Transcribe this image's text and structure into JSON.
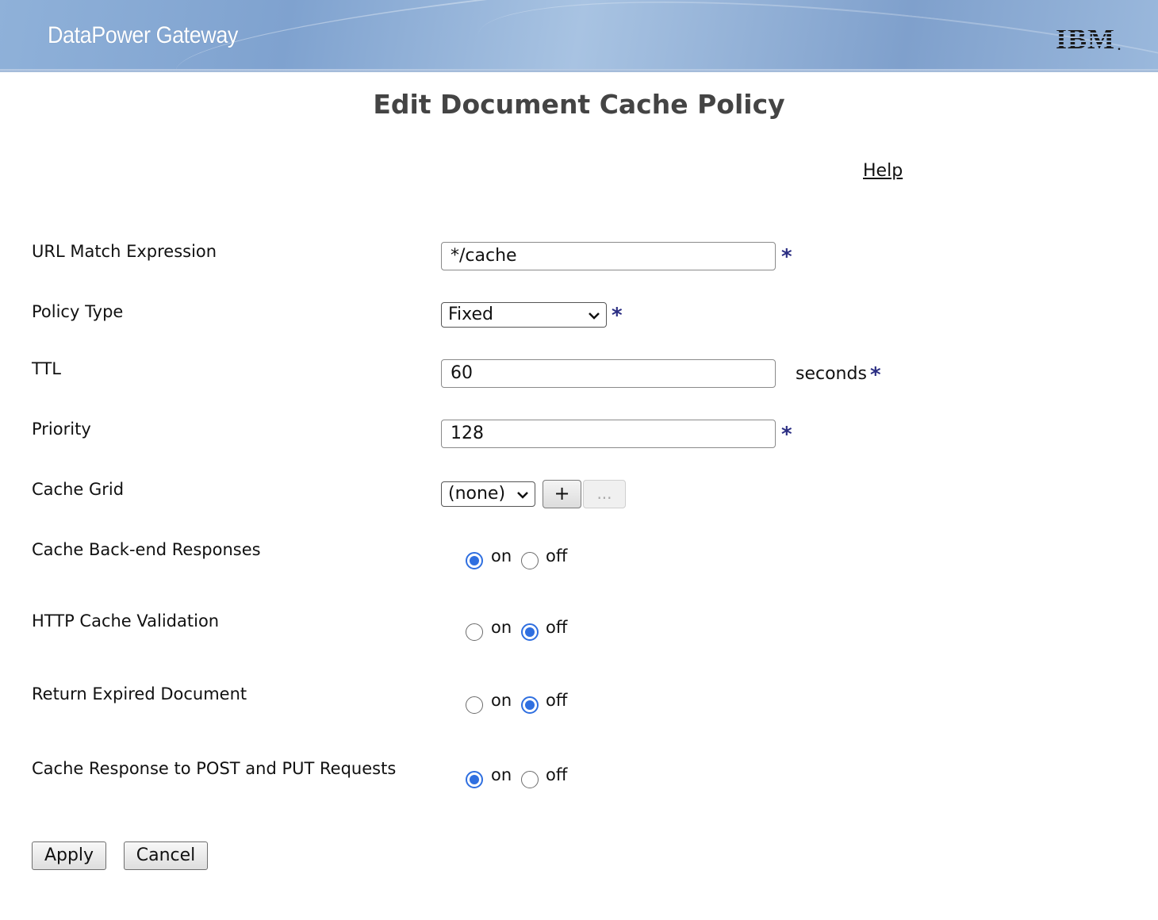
{
  "header": {
    "product_name": "DataPower Gateway",
    "logo_text": "IBM"
  },
  "page_title": "Edit Document Cache Policy",
  "help_label": "Help",
  "required_marker": "*",
  "form": {
    "url_match": {
      "label": "URL Match Expression",
      "value": "*/cache"
    },
    "policy_type": {
      "label": "Policy Type",
      "selected": "Fixed"
    },
    "ttl": {
      "label": "TTL",
      "value": "60",
      "unit": "seconds"
    },
    "priority": {
      "label": "Priority",
      "value": "128"
    },
    "cache_grid": {
      "label": "Cache Grid",
      "selected": "(none)",
      "add_label": "+",
      "edit_label": "..."
    },
    "cache_backend": {
      "label": "Cache Back-end Responses",
      "on_label": "on",
      "off_label": "off",
      "value": "on"
    },
    "http_validation": {
      "label": "HTTP Cache Validation",
      "on_label": "on",
      "off_label": "off",
      "value": "off"
    },
    "return_expired": {
      "label": "Return Expired Document",
      "on_label": "on",
      "off_label": "off",
      "value": "off"
    },
    "cache_post_put": {
      "label": "Cache Response to POST and PUT Requests",
      "on_label": "on",
      "off_label": "off",
      "value": "on"
    }
  },
  "buttons": {
    "apply": "Apply",
    "cancel": "Cancel"
  },
  "colors": {
    "required": "#2b2e83",
    "radio_accent": "#2f6fe0",
    "title": "#444444"
  }
}
